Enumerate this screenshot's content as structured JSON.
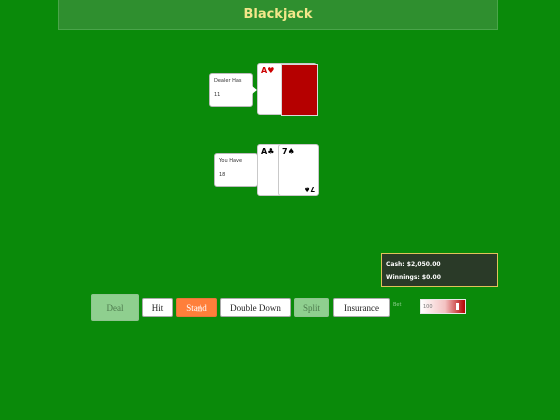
{
  "title": "Blackjack",
  "dealer": {
    "label": "Dealer Has",
    "count": "11",
    "cards": [
      {
        "rank": "A",
        "suit": "♥",
        "color": "#cc0000"
      }
    ],
    "hidden_card_color": "#b50000"
  },
  "player": {
    "label": "You Have",
    "count": "18",
    "cards": [
      {
        "rank": "A",
        "suit": "♣",
        "color": "#000000"
      },
      {
        "rank": "7",
        "suit": "♠",
        "color": "#000000"
      }
    ]
  },
  "stats": {
    "cash": "Cash: $2,050.00",
    "winnings": "Winnings: $0.00"
  },
  "controls": {
    "deal": "Deal",
    "hit": "Hit",
    "stand": "Stand",
    "double_down": "Double Down",
    "split": "Split",
    "insurance": "Insurance",
    "bet_label": "Bet",
    "bet_value": "100"
  },
  "colors": {
    "table": "#0a8a0a",
    "title": "#f3e68a",
    "active_button": "#ff7f3a",
    "disabled_button": "#8fcf8f"
  }
}
